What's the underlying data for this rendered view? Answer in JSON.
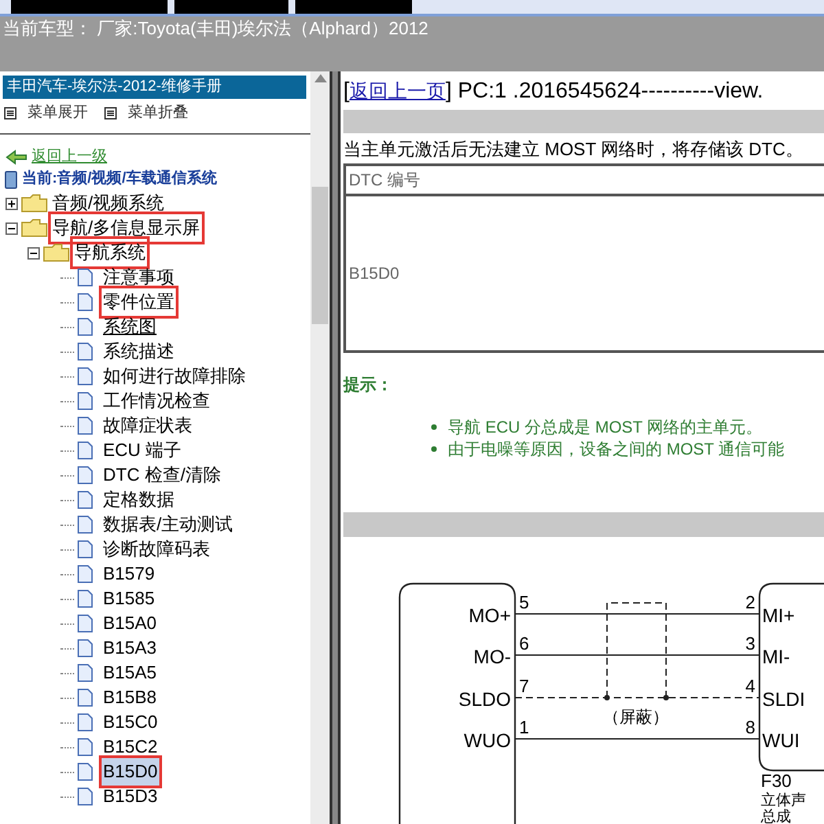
{
  "vehicle_bar": {
    "text": "当前车型： 厂家:Toyota(丰田)埃尔法（Alphard）2012"
  },
  "sidebar": {
    "title": "丰田汽车-埃尔法-2012-维修手册",
    "menu": [
      {
        "label": "菜单展开"
      },
      {
        "label": "菜单折叠"
      }
    ],
    "back_link": "返回上一级",
    "current_path": "当前:音频/视频/车载通信系统",
    "tree": [
      {
        "label": "音频/视频系统",
        "kind": "folder",
        "expanded": false,
        "marked": false
      },
      {
        "label": "导航/多信息显示屏",
        "kind": "folder",
        "expanded": true,
        "marked": true,
        "children": [
          {
            "label": "导航系统",
            "kind": "folder",
            "expanded": true,
            "marked": true,
            "children": [
              {
                "label": "注意事项",
                "kind": "page",
                "selected": false,
                "hovered": false,
                "marked": false
              },
              {
                "label": "零件位置",
                "kind": "page",
                "selected": false,
                "hovered": false,
                "marked": true
              },
              {
                "label": "系统图",
                "kind": "page",
                "selected": false,
                "hovered": true,
                "marked": false
              },
              {
                "label": "系统描述",
                "kind": "page",
                "selected": false,
                "hovered": false,
                "marked": false
              },
              {
                "label": "如何进行故障排除",
                "kind": "page",
                "selected": false,
                "hovered": false,
                "marked": false
              },
              {
                "label": "工作情况检查",
                "kind": "page",
                "selected": false,
                "hovered": false,
                "marked": false
              },
              {
                "label": "故障症状表",
                "kind": "page",
                "selected": false,
                "hovered": false,
                "marked": false
              },
              {
                "label": "ECU 端子",
                "kind": "page",
                "selected": false,
                "hovered": false,
                "marked": false
              },
              {
                "label": "DTC 检查/清除",
                "kind": "page",
                "selected": false,
                "hovered": false,
                "marked": false
              },
              {
                "label": "定格数据",
                "kind": "page",
                "selected": false,
                "hovered": false,
                "marked": false
              },
              {
                "label": "数据表/主动测试",
                "kind": "page",
                "selected": false,
                "hovered": false,
                "marked": false
              },
              {
                "label": "诊断故障码表",
                "kind": "page",
                "selected": false,
                "hovered": false,
                "marked": false
              },
              {
                "label": "B1579",
                "kind": "page",
                "selected": false,
                "hovered": false,
                "marked": false
              },
              {
                "label": "B1585",
                "kind": "page",
                "selected": false,
                "hovered": false,
                "marked": false
              },
              {
                "label": "B15A0",
                "kind": "page",
                "selected": false,
                "hovered": false,
                "marked": false
              },
              {
                "label": "B15A3",
                "kind": "page",
                "selected": false,
                "hovered": false,
                "marked": false
              },
              {
                "label": "B15A5",
                "kind": "page",
                "selected": false,
                "hovered": false,
                "marked": false
              },
              {
                "label": "B15B8",
                "kind": "page",
                "selected": false,
                "hovered": false,
                "marked": false
              },
              {
                "label": "B15C0",
                "kind": "page",
                "selected": false,
                "hovered": false,
                "marked": false
              },
              {
                "label": "B15C2",
                "kind": "page",
                "selected": false,
                "hovered": false,
                "marked": false
              },
              {
                "label": "B15D0",
                "kind": "page",
                "selected": true,
                "hovered": false,
                "marked": true
              },
              {
                "label": "B15D3",
                "kind": "page",
                "selected": false,
                "hovered": false,
                "marked": false
              }
            ]
          }
        ]
      }
    ]
  },
  "content": {
    "brackets": [
      "[",
      "]"
    ],
    "back_link": "返回上一页",
    "page_id": "PC:1 .2016545624----------view.",
    "description": "当主单元激活后无法建立 MOST 网络时，将存储该 DTC。",
    "dtc_table": {
      "header": "DTC 编号",
      "value": "B15D0"
    },
    "hint": {
      "title": "提示：",
      "items": [
        "导航 ECU 分总成是 MOST 网络的主单元。",
        "由于电噪等原因，设备之间的 MOST 通信可能"
      ]
    },
    "diagram": {
      "wires": [
        {
          "from_name": "MO+",
          "from_pin": "5",
          "to_pin": "2",
          "to_name": "MI+",
          "kind": "solid"
        },
        {
          "from_name": "MO-",
          "from_pin": "6",
          "to_pin": "3",
          "to_name": "MI-",
          "kind": "solid"
        },
        {
          "from_name": "SLDO",
          "from_pin": "7",
          "to_pin": "4",
          "to_name": "SLDI",
          "kind": "dashed"
        },
        {
          "from_name": "WUO",
          "from_pin": "1",
          "to_pin": "8",
          "to_name": "WUI",
          "kind": "solid"
        }
      ],
      "shield_label": "（屏蔽）",
      "connector_code": "F30",
      "connector_name": [
        "立体声",
        "总成"
      ]
    }
  }
}
